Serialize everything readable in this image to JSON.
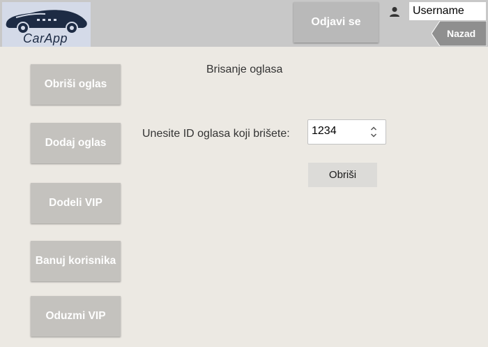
{
  "header": {
    "logo_text": "CarApp",
    "logout_label": "Odjavi se",
    "username": "Username",
    "back_label": "Nazad"
  },
  "sidebar": {
    "items": [
      {
        "label": "Obriši oglas"
      },
      {
        "label": "Dodaj oglas"
      },
      {
        "label": "Dodeli VIP"
      },
      {
        "label": "Banuj korisnika"
      },
      {
        "label": "Oduzmi VIP"
      }
    ]
  },
  "main": {
    "title": "Brisanje oglasa",
    "id_label": "Unesite ID oglasa koji brišete:",
    "id_value": "1234",
    "delete_label": "Obriši"
  },
  "colors": {
    "background": "#ece9e3",
    "header": "#c8c8c8",
    "button_dark": "#b9b9b9",
    "sidebar_button": "#c4c2be",
    "back_button": "#8f8f8f",
    "logo_bg": "#d4dae8",
    "logo_ink": "#1d2b44"
  },
  "icons": {
    "user": "user-icon",
    "spinner": "spinner-icon",
    "car": "car-logo-icon"
  }
}
